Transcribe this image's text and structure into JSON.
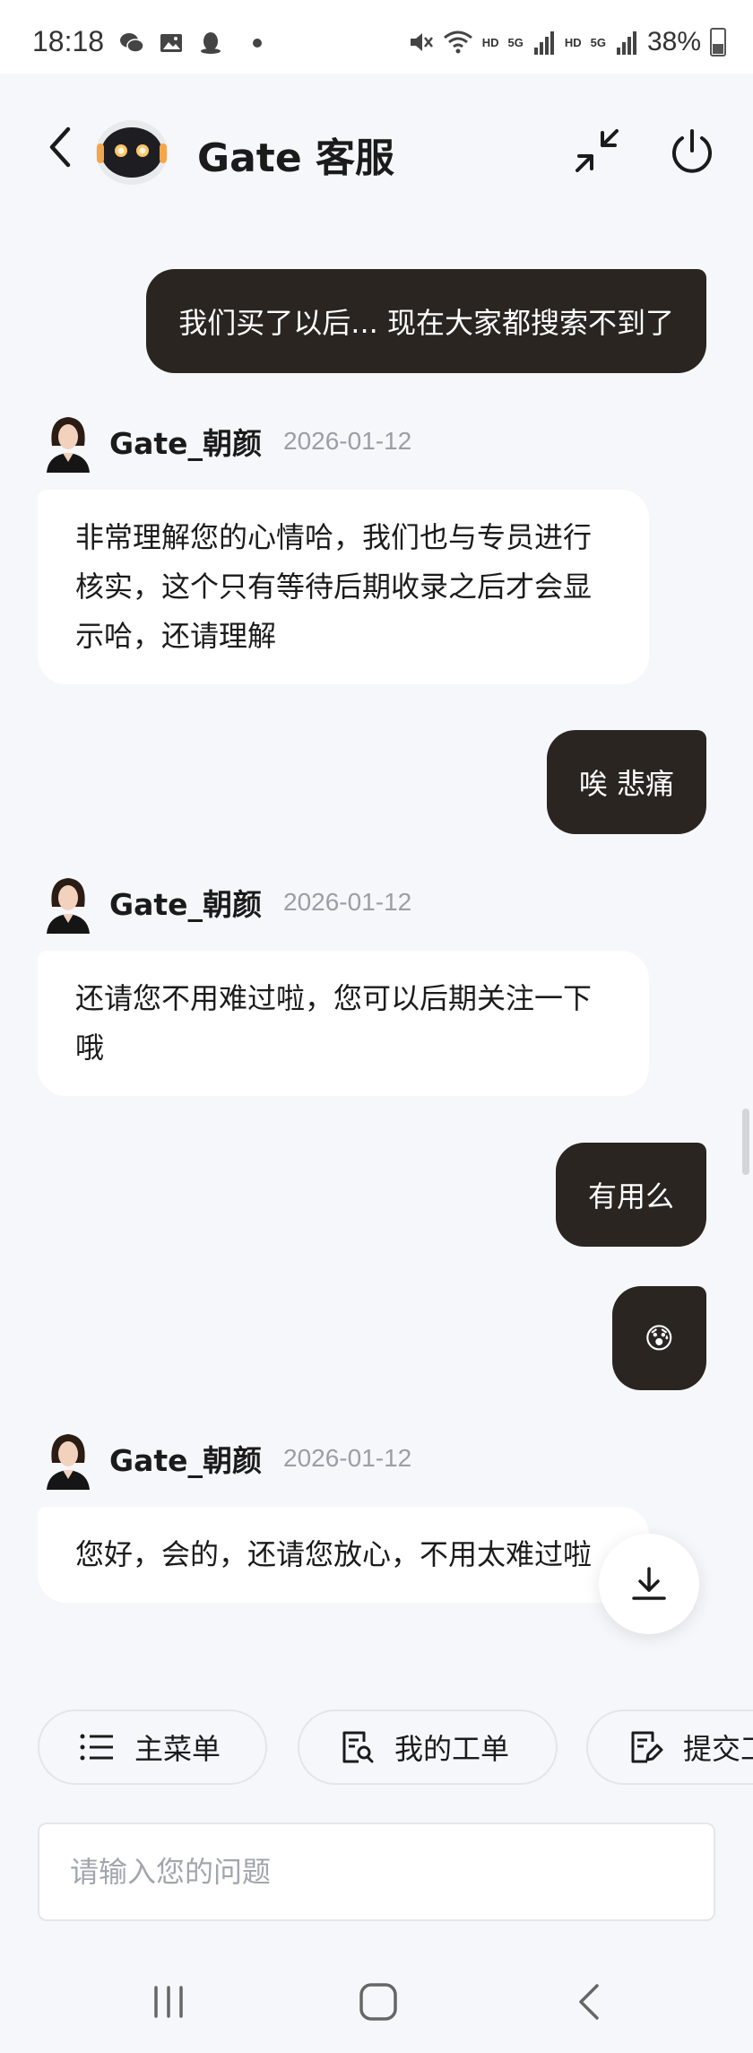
{
  "status_bar": {
    "time": "18:18",
    "hd1": "HD",
    "net1": "5G",
    "hd2": "HD",
    "net2": "5G",
    "battery": "38%"
  },
  "header": {
    "title": "Gate 客服"
  },
  "messages": [
    {
      "role": "user",
      "text": "我们买了以后... 现在大家都搜索不到了"
    },
    {
      "role": "agent",
      "name": "Gate_朝颜",
      "date": "2026-01-12",
      "text": "非常理解您的心情哈，我们也与专员进行核实，这个只有等待后期收录之后才会显示哈，还请理解"
    },
    {
      "role": "user",
      "text": "唉 悲痛"
    },
    {
      "role": "agent",
      "name": "Gate_朝颜",
      "date": "2026-01-12",
      "text": "还请您不用难过啦，您可以后期关注一下哦"
    },
    {
      "role": "user",
      "text": "有用么"
    },
    {
      "role": "user",
      "text": "😰"
    },
    {
      "role": "agent",
      "name": "Gate_朝颜",
      "date": "2026-01-12",
      "text": "您好，会的，还请您放心，不用太难过啦"
    }
  ],
  "quick_menu": [
    {
      "label": "主菜单",
      "icon": "list-icon"
    },
    {
      "label": "我的工单",
      "icon": "ticket-search-icon"
    },
    {
      "label": "提交工单",
      "icon": "edit-form-icon"
    }
  ],
  "input": {
    "placeholder": "请输入您的问题"
  },
  "colors": {
    "user_bubble": "#2a2520",
    "agent_bubble": "#ffffff",
    "background": "#f6f7fa"
  }
}
